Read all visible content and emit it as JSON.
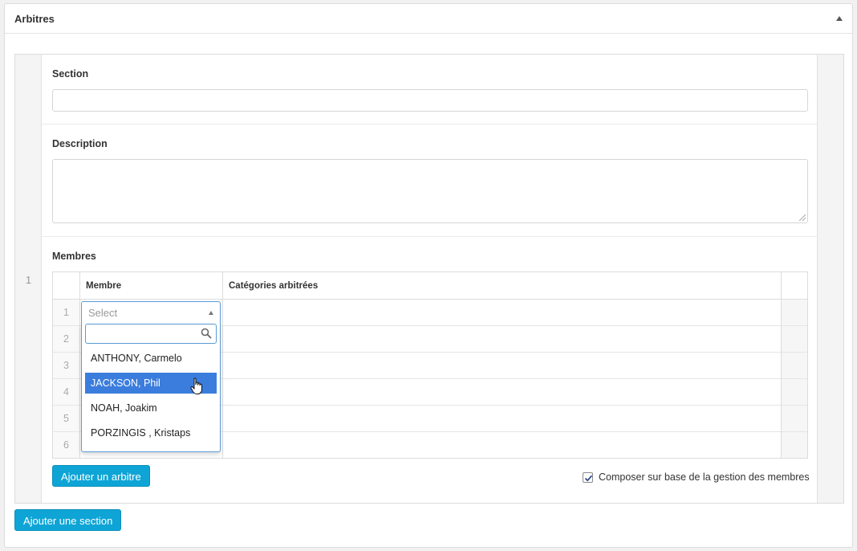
{
  "panel": {
    "title": "Arbitres"
  },
  "repeater": {
    "row_number": "1",
    "section_label": "Section",
    "section_value": "",
    "description_label": "Description",
    "description_value": "",
    "members_label": "Membres",
    "table": {
      "headers": [
        "Membre",
        "Catégories arbitrées"
      ],
      "row_numbers": [
        "1",
        "2",
        "3",
        "4",
        "5",
        "6"
      ],
      "select": {
        "placeholder": "Select",
        "search_value": "",
        "options": [
          "ANTHONY, Carmelo",
          "JACKSON, Phil",
          "NOAH, Joakim",
          "PORZINGIS , Kristaps"
        ],
        "highlighted_index": 1
      }
    },
    "add_arbitre_label": "Ajouter un arbitre",
    "compose_checkbox": {
      "label": "Composer sur base de la gestion des membres",
      "checked": true
    }
  },
  "add_section_label": "Ajouter une section",
  "colors": {
    "accent_button": "#0ea5d6",
    "highlight": "#3b7ddd",
    "focus_border": "#5b9bd5"
  }
}
